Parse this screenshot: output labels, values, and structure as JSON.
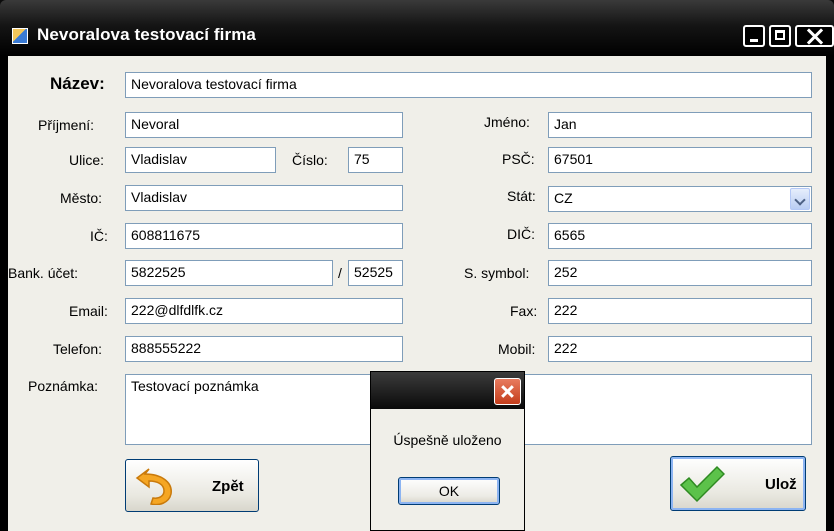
{
  "window": {
    "title": "Nevoralova testovací firma"
  },
  "form": {
    "nazev_label": "Název:",
    "nazev_value": "Nevoralova testovací firma",
    "prijmeni_label": "Příjmení:",
    "prijmeni_value": "Nevoral",
    "jmeno_label": "Jméno:",
    "jmeno_value": "Jan",
    "ulice_label": "Ulice:",
    "ulice_value": "Vladislav",
    "cislo_label": "Číslo:",
    "cislo_value": "75",
    "psc_label": "PSČ:",
    "psc_value": "67501",
    "mesto_label": "Město:",
    "mesto_value": "Vladislav",
    "stat_label": "Stát:",
    "stat_value": "CZ",
    "ic_label": "IČ:",
    "ic_value": "608811675",
    "dic_label": "DIČ:",
    "dic_value": "6565",
    "bank_label": "Bank. účet:",
    "bank_account": "5822525",
    "bank_slash": "/",
    "bank_code": "52525",
    "ssymbol_label": "S. symbol:",
    "ssymbol_value": "252",
    "email_label": "Email:",
    "email_value": "222@dlfdlfk.cz",
    "fax_label": "Fax:",
    "fax_value": "222",
    "telefon_label": "Telefon:",
    "telefon_value": "888555222",
    "mobil_label": "Mobil:",
    "mobil_value": "222",
    "poznamka_label": "Poznámka:",
    "poznamka_value": "Testovací poznámka"
  },
  "buttons": {
    "back": "Zpět",
    "save": "Ulož"
  },
  "dialog": {
    "message": "Úspešně uloženo",
    "ok": "OK"
  }
}
